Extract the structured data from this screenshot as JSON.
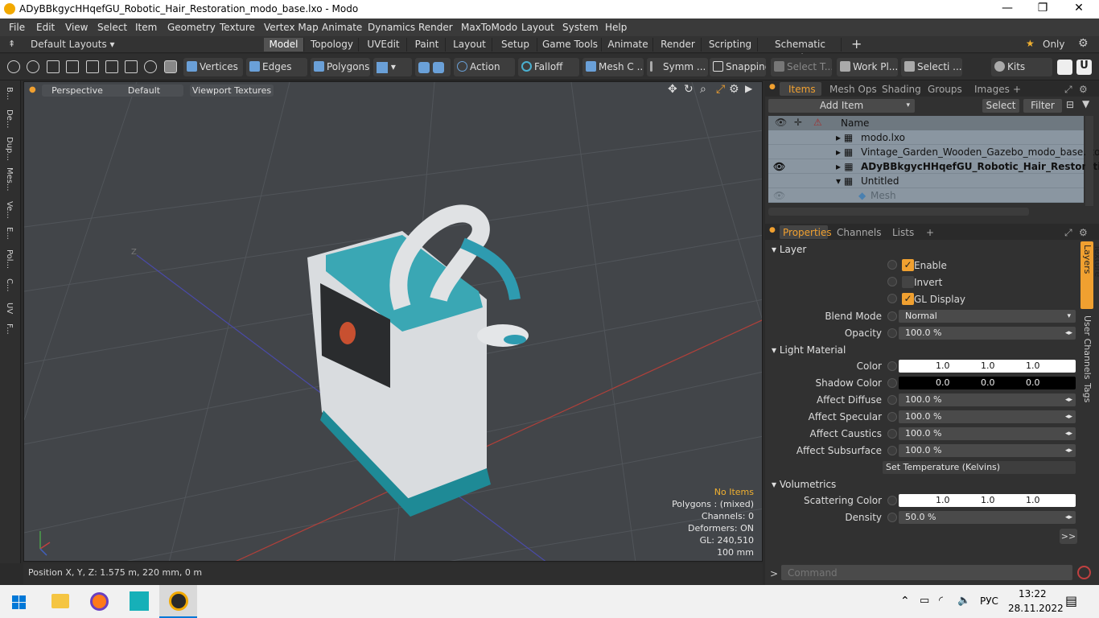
{
  "window": {
    "title": "ADyBBkgycHHqefGU_Robotic_Hair_Restoration_modo_base.lxo - Modo",
    "minimize": "—",
    "maximize": "❐",
    "close": "✕"
  },
  "menu": [
    "File",
    "Edit",
    "View",
    "Select",
    "Item",
    "Geometry",
    "Texture",
    "Vertex Map",
    "Animate",
    "Dynamics",
    "Render",
    "MaxToModo",
    "Layout",
    "System",
    "Help"
  ],
  "layoutbar": {
    "layouts_label": "Default Layouts ▾",
    "tabs": [
      "Model",
      "Topology",
      "UVEdit",
      "Paint",
      "Layout",
      "Setup",
      "Game Tools",
      "Animate",
      "Render",
      "Scripting",
      "Schematic Fusion"
    ],
    "add": "+",
    "only_label": "Only",
    "star": "★"
  },
  "toolbar": {
    "vertices": "Vertices",
    "edges": "Edges",
    "polygons": "Polygons",
    "action": "Action",
    "falloff": "Falloff",
    "meshc": "Mesh C ...",
    "symm": "Symm ...",
    "snapping": "Snapping",
    "selectt": "Select T...",
    "workpl": "Work Pl...",
    "selecti": "Selecti ...",
    "kits": "Kits"
  },
  "left_tabs": [
    "B...",
    "De...",
    "Dup...",
    "Mes...",
    "Ve...",
    "E...",
    "Pol...",
    "C...",
    "UV",
    "F..."
  ],
  "viewport": {
    "perspective": "Perspective",
    "default": "Default",
    "textures": "Viewport Textures",
    "axis_z": "Z",
    "stats": {
      "no_items": "No Items",
      "polygons": "Polygons : (mixed)",
      "channels": "Channels: 0",
      "deformers": "Deformers: ON",
      "gl": "GL: 240,510",
      "scale": "100 mm"
    }
  },
  "status": {
    "position": "Position X, Y, Z:   1.575 m, 220 mm, 0 m"
  },
  "items_panel": {
    "tabs": [
      "Items",
      "Mesh Ops",
      "Shading",
      "Groups",
      "Images"
    ],
    "add_item": "Add Item",
    "select": "Select",
    "filter": "Filter",
    "col_name": "Name",
    "rows": [
      {
        "name": "modo.lxo"
      },
      {
        "name": "Vintage_Garden_Wooden_Gazebo_modo_base.lxo*"
      },
      {
        "name": "ADyBBkgycHHqefGU_Robotic_Hair_Restoratio..."
      },
      {
        "name": "Untitled"
      },
      {
        "name": "Mesh"
      }
    ]
  },
  "properties": {
    "tabs": [
      "Properties",
      "Channels",
      "Lists"
    ],
    "side_tabs": [
      "Texture Layers",
      "User Channels",
      "Tags"
    ],
    "layer": "Layer",
    "enable": "Enable",
    "invert": "Invert",
    "gl_display": "GL Display",
    "blend_mode_label": "Blend Mode",
    "blend_mode": "Normal",
    "opacity_label": "Opacity",
    "opacity": "100.0 %",
    "light_material": "Light Material",
    "color_label": "Color",
    "color": [
      "1.0",
      "1.0",
      "1.0"
    ],
    "shadow_label": "Shadow Color",
    "shadow": [
      "0.0",
      "0.0",
      "0.0"
    ],
    "affect_diffuse_label": "Affect Diffuse",
    "affect_diffuse": "100.0 %",
    "affect_specular_label": "Affect Specular",
    "affect_specular": "100.0 %",
    "affect_caustics_label": "Affect Caustics",
    "affect_caustics": "100.0 %",
    "affect_subsurface_label": "Affect Subsurface",
    "affect_subsurface": "100.0 %",
    "set_temp": "Set Temperature (Kelvins)",
    "volumetrics": "Volumetrics",
    "scatter_label": "Scattering Color",
    "scatter": [
      "1.0",
      "1.0",
      "1.0"
    ],
    "density_label": "Density",
    "density": "50.0 %",
    "more": ">>"
  },
  "command": {
    "placeholder": "Command"
  },
  "taskbar": {
    "lang": "РУС",
    "time": "13:22",
    "date": "28.11.2022"
  }
}
